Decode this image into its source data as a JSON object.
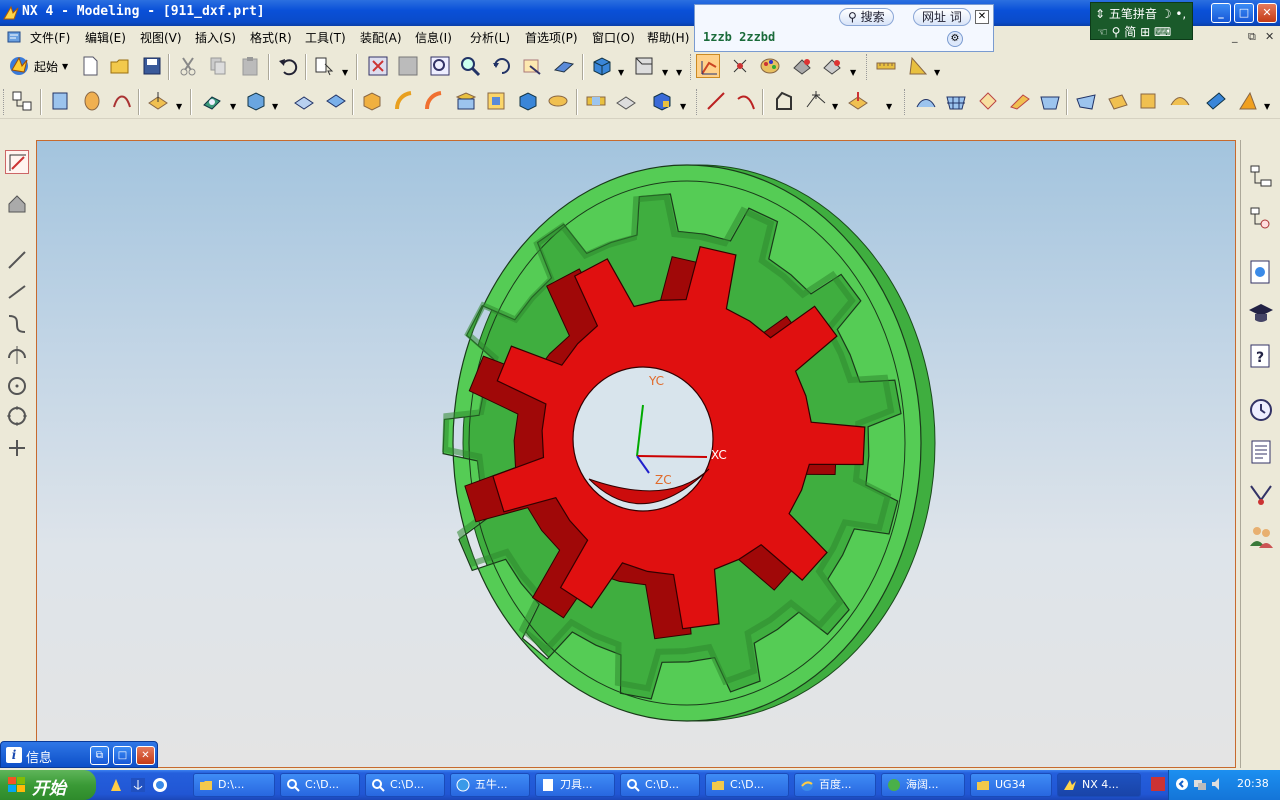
{
  "window": {
    "title": "NX 4 - Modeling - [911_dxf.prt]",
    "minimize": "_",
    "maximize": "□",
    "close": "✕"
  },
  "menu": {
    "items": [
      "文件(F)",
      "编辑(E)",
      "视图(V)",
      "插入(S)",
      "格式(R)",
      "工具(T)",
      "装配(A)",
      "信息(I)",
      "分析(L)",
      "首选项(P)",
      "窗口(O)",
      "帮助(H)"
    ],
    "mdi_min": "_",
    "mdi_restore": "⧉",
    "mdi_close": "✕"
  },
  "ime_popup": {
    "search_label": "搜索",
    "url_label": "网址",
    "word_label": "词",
    "input_text": "1zzb 2zzbd",
    "close": "✕"
  },
  "ime_status": {
    "name": "五笔拼音",
    "mode": "简"
  },
  "toolbar": {
    "start_label": "起始"
  },
  "viewport": {
    "label_yc": "YC",
    "label_xc": "XC",
    "label_zc": "ZC",
    "colors": {
      "ring_gear": "#55cc55",
      "pinion_gear": "#e01010",
      "axis_x": "#cc0000",
      "axis_y": "#00aa00",
      "axis_z": "#2020cc"
    }
  },
  "info_panel": {
    "icon": "i",
    "label": "信息"
  },
  "taskbar": {
    "start_label": "开始",
    "tasks": [
      "D:\\...",
      "C:\\D...",
      "C:\\D...",
      "五牛...",
      "刀具...",
      "C:\\D...",
      "C:\\D...",
      "百度...",
      "海阔...",
      "UG34",
      "NX 4..."
    ],
    "clock": "20:38"
  }
}
